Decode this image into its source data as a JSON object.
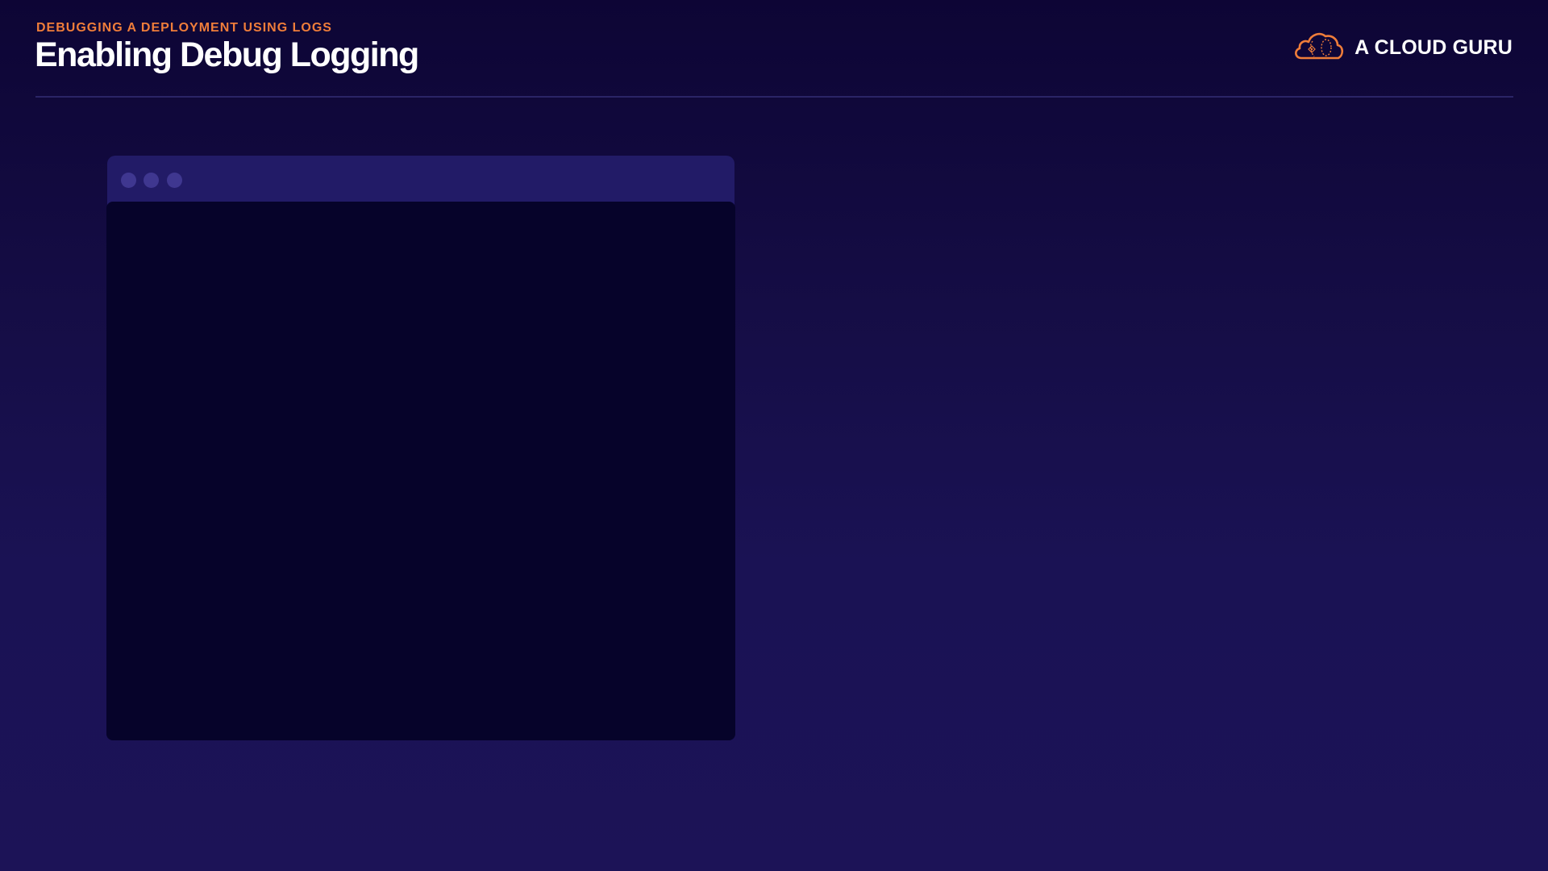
{
  "header": {
    "eyebrow": "DEBUGGING A DEPLOYMENT USING LOGS",
    "title": "Enabling Debug Logging"
  },
  "brand": {
    "name": "A CLOUD GURU",
    "icon": "cloud-logo-icon"
  },
  "window": {
    "controls": [
      "dot",
      "dot",
      "dot"
    ]
  },
  "colors": {
    "background_top": "#0d0535",
    "background_bottom": "#1c1357",
    "accent": "#ef7d3a",
    "window_titlebar": "#221b67",
    "window_dots": "#3f3790",
    "window_content": "#06032a",
    "divider": "#2a2466"
  }
}
